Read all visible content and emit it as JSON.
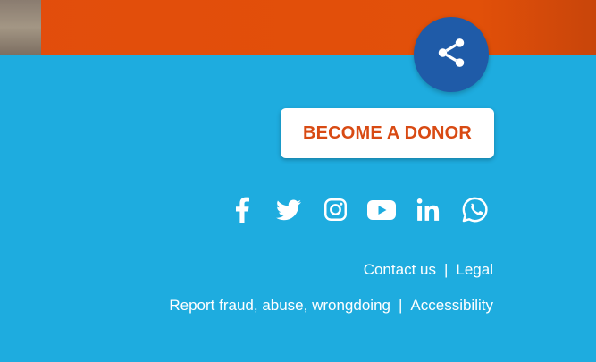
{
  "header": {
    "share_icon": "share-icon"
  },
  "cta": {
    "label": "BECOME A DONOR"
  },
  "social": [
    {
      "name": "facebook-icon"
    },
    {
      "name": "twitter-icon"
    },
    {
      "name": "instagram-icon"
    },
    {
      "name": "youtube-icon"
    },
    {
      "name": "linkedin-icon"
    },
    {
      "name": "whatsapp-icon"
    }
  ],
  "footer": {
    "row1": {
      "contact": "Contact us",
      "sep": "|",
      "legal": "Legal"
    },
    "row2": {
      "report": "Report fraud, abuse, wrongdoing",
      "sep": "|",
      "accessibility": "Accessibility"
    }
  },
  "colors": {
    "background": "#1eacdf",
    "banner": "#e24d0c",
    "share_button": "#1f5ba8",
    "cta_text": "#d84a13"
  }
}
